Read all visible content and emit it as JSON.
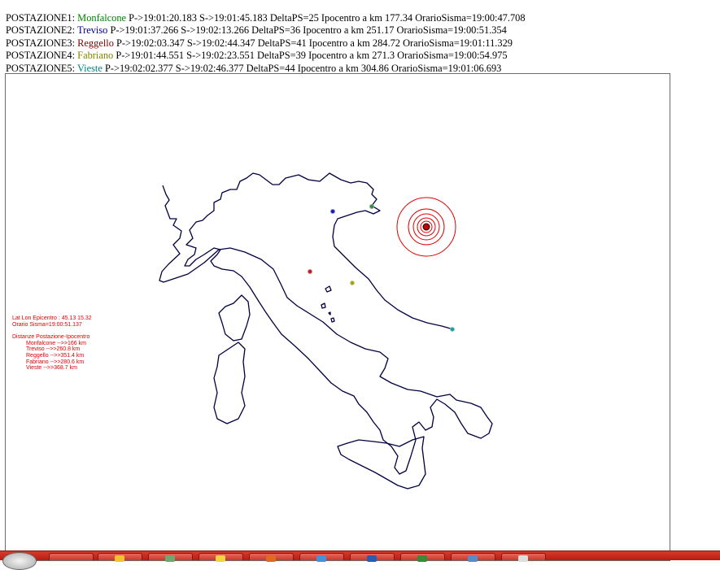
{
  "stations": [
    {
      "label": "POSTAZIONE1:",
      "name": "Monfalcone",
      "color": "#008000",
      "details": "P->19:01:20.183 S->19:01:45.183 DeltaPS=25 Ipocentro a km 177.34 OrarioSisma=19:00:47.708"
    },
    {
      "label": "POSTAZIONE2:",
      "name": "Treviso",
      "color": "#000080",
      "details": "P->19:01:37.266 S->19:02:13.266 DeltaPS=36 Ipocentro a km 251.17 OrarioSisma=19:00:51.354"
    },
    {
      "label": "POSTAZIONE3:",
      "name": "Reggello",
      "color": "#800000",
      "details": "P->19:02:03.347 S->19:02:44.347 DeltaPS=41 Ipocentro a km 284.72 OrarioSisma=19:01:11.329"
    },
    {
      "label": "POSTAZIONE4:",
      "name": "Fabriano",
      "color": "#808000",
      "details": "P->19:01:44.551 S->19:02:23.551 DeltaPS=39 Ipocentro a km 271.3 OrarioSisma=19:00:54.975"
    },
    {
      "label": "POSTAZIONE5:",
      "name": "Vieste",
      "color": "#008080",
      "details": "P->19:02:02.377 S->19:02:46.377 DeltaPS=44 Ipocentro a km 304.86 OrarioSisma=19:01:06.693"
    }
  ],
  "info": {
    "latlon": "Lat Lon Epicentro : 45.13  15.32",
    "orario": "Orario Sisma=19:00:51.137",
    "distanze_title": "Distanze Postazione-Ipocentro",
    "distances": [
      "Monfalcone -->>166 km",
      "Treviso -->>260.8 km",
      "Reggello -->>351.4 km",
      "Fabriano -->>280.6 km",
      "Vieste -->>368.7 km"
    ]
  },
  "colors": {
    "epicenter": "#e00000",
    "info_text": "#e00000",
    "coastline": "#000040",
    "taskbar": "#c8392b"
  },
  "map": {
    "stations": [
      {
        "name": "Monfalcone",
        "color": "#2e8b57"
      },
      {
        "name": "Treviso",
        "color": "#1a1aaa"
      },
      {
        "name": "Reggello",
        "color": "#b22222"
      },
      {
        "name": "Fabriano",
        "color": "#a0a020"
      },
      {
        "name": "Vieste",
        "color": "#1a9aa0"
      }
    ]
  }
}
